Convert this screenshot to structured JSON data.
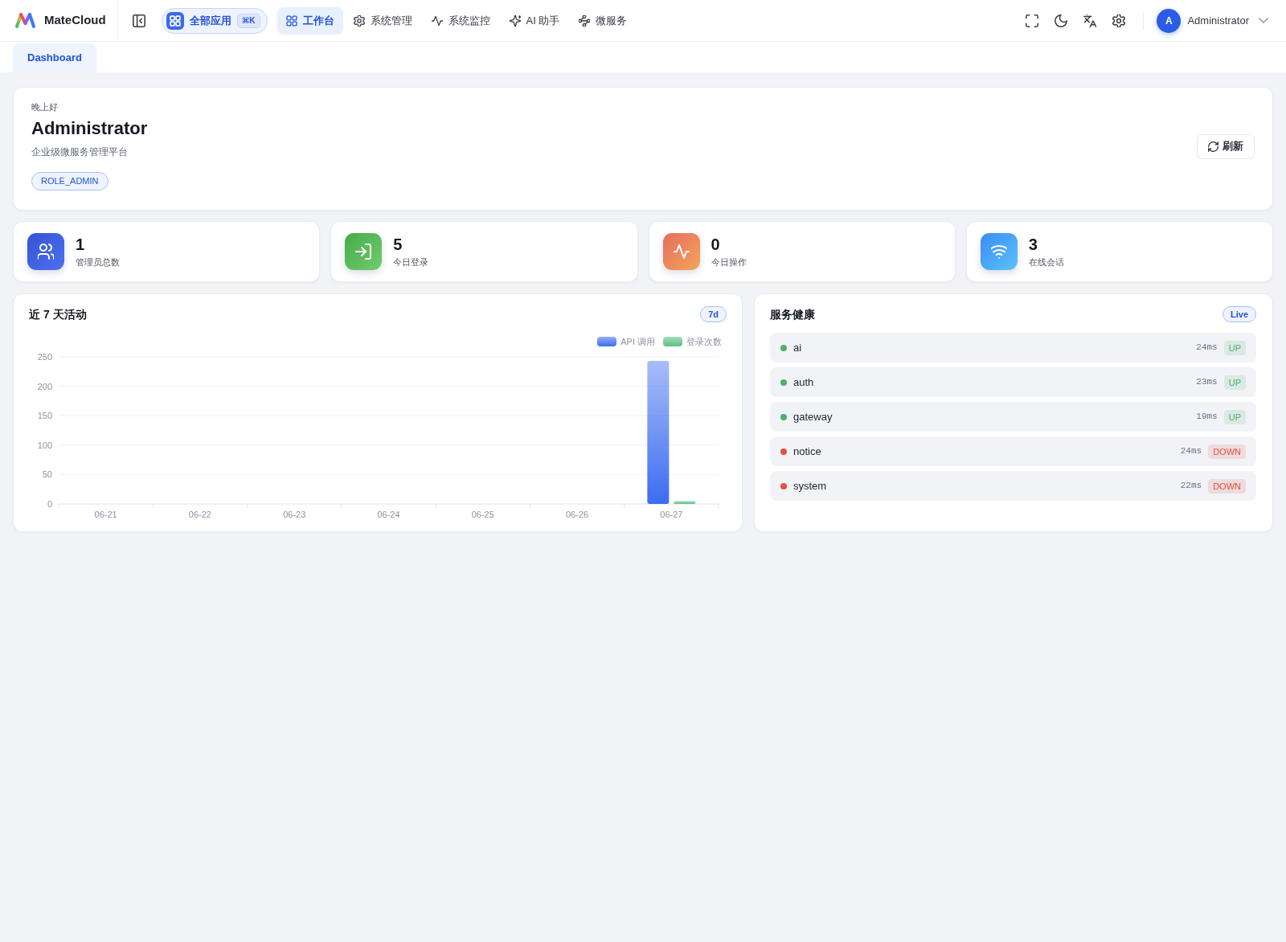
{
  "header": {
    "brand": "MateCloud",
    "all_apps": {
      "label": "全部应用",
      "shortcut": "⌘K"
    },
    "nav": [
      {
        "kind": "grid",
        "label": "工作台",
        "selected": true
      },
      {
        "kind": "gear",
        "label": "系统管理",
        "selected": false
      },
      {
        "kind": "pulse",
        "label": "系统监控",
        "selected": false
      },
      {
        "kind": "sparkle",
        "label": "AI 助手",
        "selected": false
      },
      {
        "kind": "nodes",
        "label": "微服务",
        "selected": false
      }
    ],
    "user": {
      "avatar": "A",
      "name": "Administrator"
    }
  },
  "tabs": [
    {
      "label": "Dashboard",
      "selected": true
    }
  ],
  "welcome": {
    "greeting": "晚上好",
    "name": "Administrator",
    "subtitle": "企业级微服务管理平台",
    "role": "ROLE_ADMIN",
    "refresh_button": "刷新"
  },
  "stats": [
    {
      "kind": "users",
      "value": "1",
      "label": "管理员总数"
    },
    {
      "kind": "login",
      "value": "5",
      "label": "今日登录"
    },
    {
      "kind": "pulse",
      "value": "0",
      "label": "今日操作"
    },
    {
      "kind": "wifi",
      "value": "3",
      "label": "在线会话"
    }
  ],
  "activity": {
    "title": "近 7 天活动",
    "badge": "7d",
    "chart_data": {
      "type": "bar",
      "categories": [
        "06-21",
        "06-22",
        "06-23",
        "06-24",
        "06-25",
        "06-26",
        "06-27"
      ],
      "series": [
        {
          "name": "API 调用",
          "color": "#3d6cf0",
          "values": [
            0,
            0,
            0,
            0,
            0,
            0,
            243
          ]
        },
        {
          "name": "登录次数",
          "color": "#5cbf85",
          "values": [
            0,
            0,
            0,
            0,
            0,
            0,
            5
          ]
        }
      ],
      "ylim": [
        0,
        250
      ],
      "yticks": [
        0,
        50,
        100,
        150,
        200,
        250
      ],
      "grid": true,
      "legend": "top-right"
    }
  },
  "service_health": {
    "title": "服务健康",
    "badge": "Live",
    "services": [
      {
        "name": "ai",
        "latency": "24ms",
        "status": "UP",
        "color": "#4caf6e"
      },
      {
        "name": "auth",
        "latency": "23ms",
        "status": "UP",
        "color": "#4caf6e"
      },
      {
        "name": "gateway",
        "latency": "19ms",
        "status": "UP",
        "color": "#4caf6e"
      },
      {
        "name": "notice",
        "latency": "24ms",
        "status": "DOWN",
        "color": "#e5513f"
      },
      {
        "name": "system",
        "latency": "22ms",
        "status": "DOWN",
        "color": "#e5513f"
      }
    ]
  }
}
